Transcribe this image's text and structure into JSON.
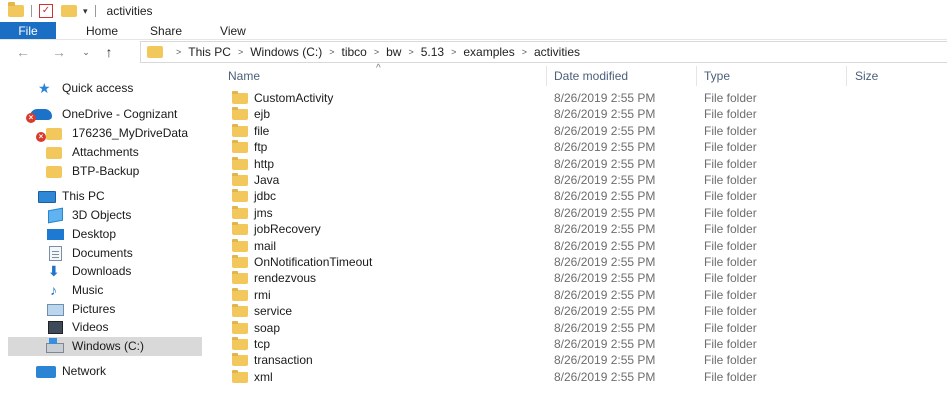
{
  "window": {
    "title": "activities"
  },
  "ribbon": {
    "tabs": [
      "File",
      "Home",
      "Share",
      "View"
    ]
  },
  "address": {
    "crumbs": [
      "This PC",
      "Windows (C:)",
      "tibco",
      "bw",
      "5.13",
      "examples",
      "activities"
    ]
  },
  "sidebar": {
    "items": [
      {
        "label": "Quick access",
        "icon": "star-icon"
      },
      {
        "label": "OneDrive - Cognizant",
        "icon": "onedrive-cloud-icon"
      },
      {
        "label": "176236_MyDriveData",
        "icon": "folder-icon"
      },
      {
        "label": "Attachments",
        "icon": "folder-icon"
      },
      {
        "label": "BTP-Backup",
        "icon": "folder-icon"
      },
      {
        "label": "This PC",
        "icon": "computer-icon"
      },
      {
        "label": "3D Objects",
        "icon": "3d-objects-icon"
      },
      {
        "label": "Desktop",
        "icon": "desktop-icon"
      },
      {
        "label": "Documents",
        "icon": "documents-icon"
      },
      {
        "label": "Downloads",
        "icon": "downloads-icon"
      },
      {
        "label": "Music",
        "icon": "music-icon"
      },
      {
        "label": "Pictures",
        "icon": "pictures-icon"
      },
      {
        "label": "Videos",
        "icon": "videos-icon"
      },
      {
        "label": "Windows (C:)",
        "icon": "drive-icon",
        "selected": true
      },
      {
        "label": "Network",
        "icon": "network-icon"
      }
    ]
  },
  "columns": {
    "name": "Name",
    "date": "Date modified",
    "type": "Type",
    "size": "Size"
  },
  "files": [
    {
      "name": "CustomActivity",
      "date": "8/26/2019 2:55 PM",
      "type": "File folder"
    },
    {
      "name": "ejb",
      "date": "8/26/2019 2:55 PM",
      "type": "File folder"
    },
    {
      "name": "file",
      "date": "8/26/2019 2:55 PM",
      "type": "File folder"
    },
    {
      "name": "ftp",
      "date": "8/26/2019 2:55 PM",
      "type": "File folder"
    },
    {
      "name": "http",
      "date": "8/26/2019 2:55 PM",
      "type": "File folder"
    },
    {
      "name": "Java",
      "date": "8/26/2019 2:55 PM",
      "type": "File folder"
    },
    {
      "name": "jdbc",
      "date": "8/26/2019 2:55 PM",
      "type": "File folder"
    },
    {
      "name": "jms",
      "date": "8/26/2019 2:55 PM",
      "type": "File folder"
    },
    {
      "name": "jobRecovery",
      "date": "8/26/2019 2:55 PM",
      "type": "File folder"
    },
    {
      "name": "mail",
      "date": "8/26/2019 2:55 PM",
      "type": "File folder"
    },
    {
      "name": "OnNotificationTimeout",
      "date": "8/26/2019 2:55 PM",
      "type": "File folder"
    },
    {
      "name": "rendezvous",
      "date": "8/26/2019 2:55 PM",
      "type": "File folder"
    },
    {
      "name": "rmi",
      "date": "8/26/2019 2:55 PM",
      "type": "File folder"
    },
    {
      "name": "service",
      "date": "8/26/2019 2:55 PM",
      "type": "File folder"
    },
    {
      "name": "soap",
      "date": "8/26/2019 2:55 PM",
      "type": "File folder"
    },
    {
      "name": "tcp",
      "date": "8/26/2019 2:55 PM",
      "type": "File folder"
    },
    {
      "name": "transaction",
      "date": "8/26/2019 2:55 PM",
      "type": "File folder"
    },
    {
      "name": "xml",
      "date": "8/26/2019 2:55 PM",
      "type": "File folder"
    }
  ],
  "colors": {
    "file_tab": "#1a6fc4",
    "folder": "#f2c75c",
    "selected_row": "#d9d9d9",
    "header_text": "#4c607a"
  }
}
